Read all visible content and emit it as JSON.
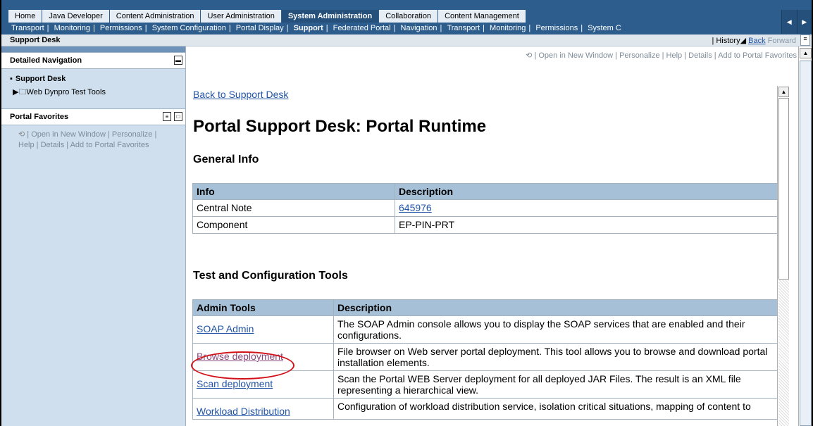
{
  "top_tabs": [
    "Home",
    "Java Developer",
    "Content Administration",
    "User Administration",
    "System Administration",
    "Collaboration",
    "Content Management"
  ],
  "sub_nav": [
    "Transport",
    "Monitoring",
    "Permissions",
    "System Configuration",
    "Portal Display",
    "Support",
    "Federated Portal",
    "Navigation",
    "Transport",
    "Monitoring",
    "Permissions",
    "System C"
  ],
  "path_title": "Support Desk",
  "history": {
    "history": "History",
    "back": "Back",
    "forward": "Forward"
  },
  "left": {
    "detailed_nav_title": "Detailed Navigation",
    "current_item": "Support Desk",
    "item2": "Web Dynpro Test Tools",
    "favorites_title": "Portal Favorites",
    "favorites_line1": "| Open in New Window | Personalize |",
    "favorites_line2": "Help | Details | Add to Portal Favorites"
  },
  "content_tools": "| Open in New Window | Personalize | Help | Details | Add to Portal Favorites",
  "back_link": "Back to Support Desk",
  "page_title": "Portal Support Desk: Portal Runtime",
  "general_info": {
    "heading": "General Info",
    "col1": "Info",
    "col2": "Description",
    "rows": [
      {
        "info": "Central Note",
        "desc": "645976"
      },
      {
        "info": "Component",
        "desc": "EP-PIN-PRT"
      }
    ]
  },
  "tools": {
    "heading": "Test and Configuration Tools",
    "col1": "Admin Tools",
    "col2": "Description",
    "rows": [
      {
        "name": "SOAP Admin",
        "desc": "The SOAP Admin console allows you to display the SOAP services that are enabled and their configurations."
      },
      {
        "name": "Browse deployment",
        "desc": "File browser on Web server portal deployment. This tool allows you to browse and download portal installation elements."
      },
      {
        "name": "Scan deployment",
        "desc": "Scan the Portal WEB Server deployment for all deployed JAR Files. The result is an XML file representing a hierarchical view."
      },
      {
        "name": "Workload Distribution",
        "desc": "Configuration of workload distribution service, isolation critical situations, mapping of content to"
      }
    ]
  },
  "colors": {
    "nav": "#2d5d8c",
    "header_cell": "#a6c0d8",
    "link": "#2254a6",
    "highlight": "#d31018"
  }
}
